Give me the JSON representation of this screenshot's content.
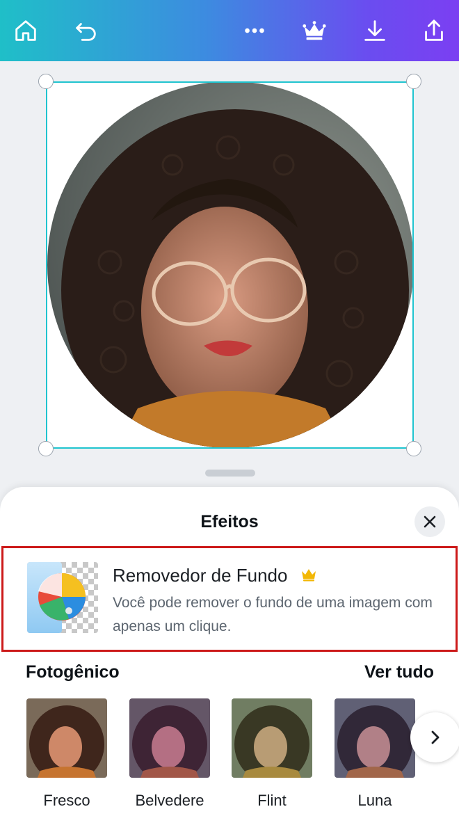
{
  "toolbar": {
    "icons": [
      "home-icon",
      "undo-icon",
      "more-icon",
      "crown-icon",
      "download-icon",
      "share-icon"
    ]
  },
  "panel": {
    "title": "Efeitos",
    "close_icon": "close-icon"
  },
  "featured_effect": {
    "name": "Removedor de Fundo",
    "badge_icon": "crown-icon",
    "description": "Você pode remover o fundo de uma imagem com apenas um clique."
  },
  "filters_section": {
    "title": "Fotogênico",
    "see_all": "Ver tudo",
    "items": [
      {
        "label": "Fresco",
        "tint": "#b96a4a"
      },
      {
        "label": "Belvedere",
        "tint": "#8a4a7a"
      },
      {
        "label": "Flint",
        "tint": "#7a8a55"
      },
      {
        "label": "Luna",
        "tint": "#6a5a8a"
      }
    ]
  },
  "colors": {
    "accent": "#20c4cf",
    "highlight_border": "#cc1a1a",
    "gradient_start": "#1fbfc8",
    "gradient_end": "#7b3ff2"
  }
}
